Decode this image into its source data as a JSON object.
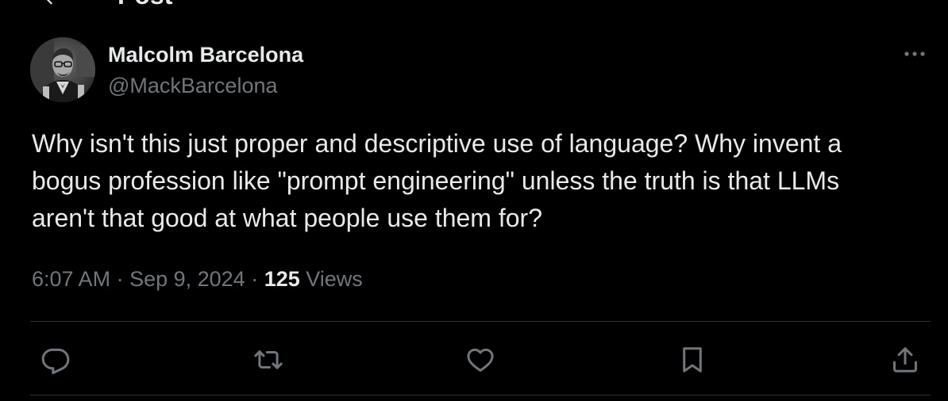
{
  "header": {
    "title": "Post",
    "back_icon": "arrow-left-icon"
  },
  "author": {
    "display_name": "Malcolm Barcelona",
    "handle": "@MackBarcelona",
    "avatar": "avatar-photo"
  },
  "tweet": {
    "text": "Why isn't this just proper and descriptive use of language?  Why invent a\nbogus profession like \"prompt engineering\" unless the truth is that LLMs\naren't that good at what people use them for?"
  },
  "meta": {
    "time": "6:07 AM",
    "separator": " · ",
    "date": "Sep 9, 2024",
    "views_count": "125",
    "views_label": " Views"
  },
  "actions": [
    {
      "icon": "reply-icon"
    },
    {
      "icon": "retweet-icon"
    },
    {
      "icon": "like-icon"
    },
    {
      "icon": "bookmark-icon"
    },
    {
      "icon": "share-icon"
    }
  ],
  "more_icon": "more-options-icon",
  "colors": {
    "background": "#000000",
    "primary_text": "#e7e9ea",
    "secondary_text": "#71767b",
    "divider": "#2f3336"
  }
}
